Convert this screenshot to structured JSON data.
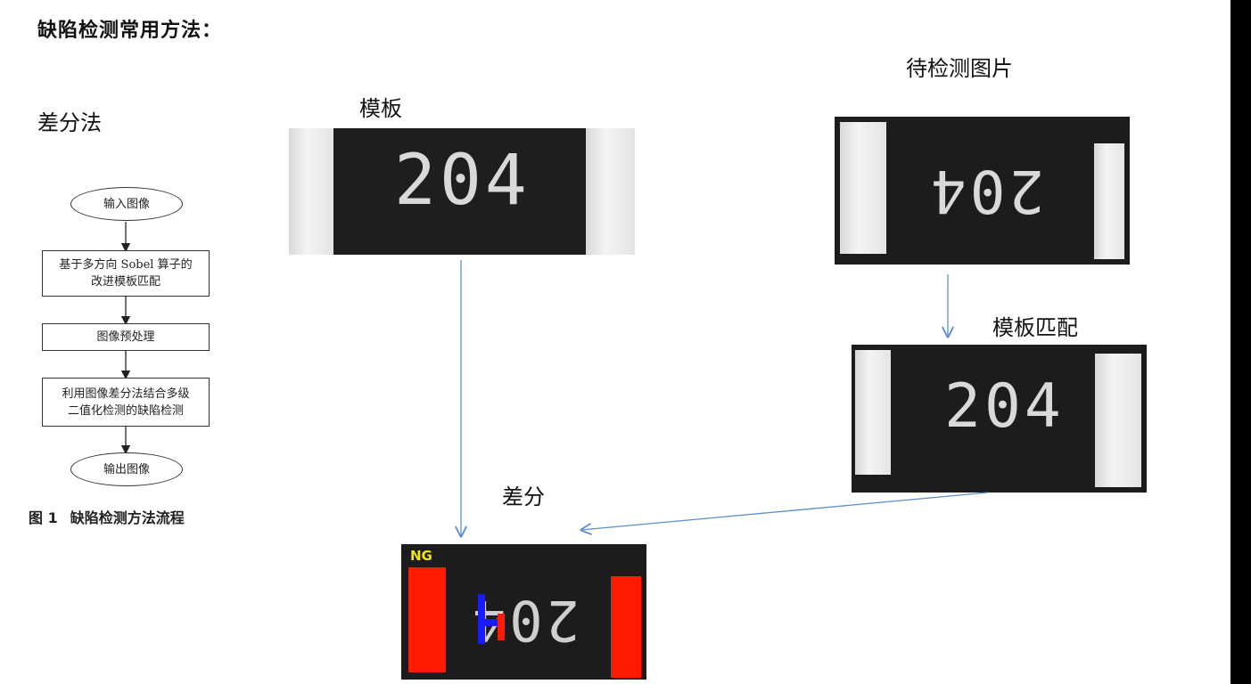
{
  "slide": {
    "title": "缺陷检测常用方法：",
    "method_label": "差分法",
    "template_label": "模板",
    "test_label": "待检测图片",
    "match_label": "模板匹配",
    "diff_label": "差分"
  },
  "flowchart": {
    "nodes": [
      "输入图像",
      "基于多方向 Sobel 算子的\n改进模板匹配",
      "图像预处理",
      "利用图像差分法结合多级\n二值化检测的缺陷检测",
      "输出图像"
    ],
    "caption_number": "图 1",
    "caption_text": "缺陷检测方法流程"
  },
  "images": {
    "template_code": "204",
    "test_code": "204",
    "match_code": "204",
    "diff_code": "204",
    "diff_badge": "NG"
  },
  "colors": {
    "arrow": "#5b8fd0",
    "defect_red": "#ff1a00",
    "defect_blue": "#1a1aff",
    "badge": "#f1e600"
  }
}
